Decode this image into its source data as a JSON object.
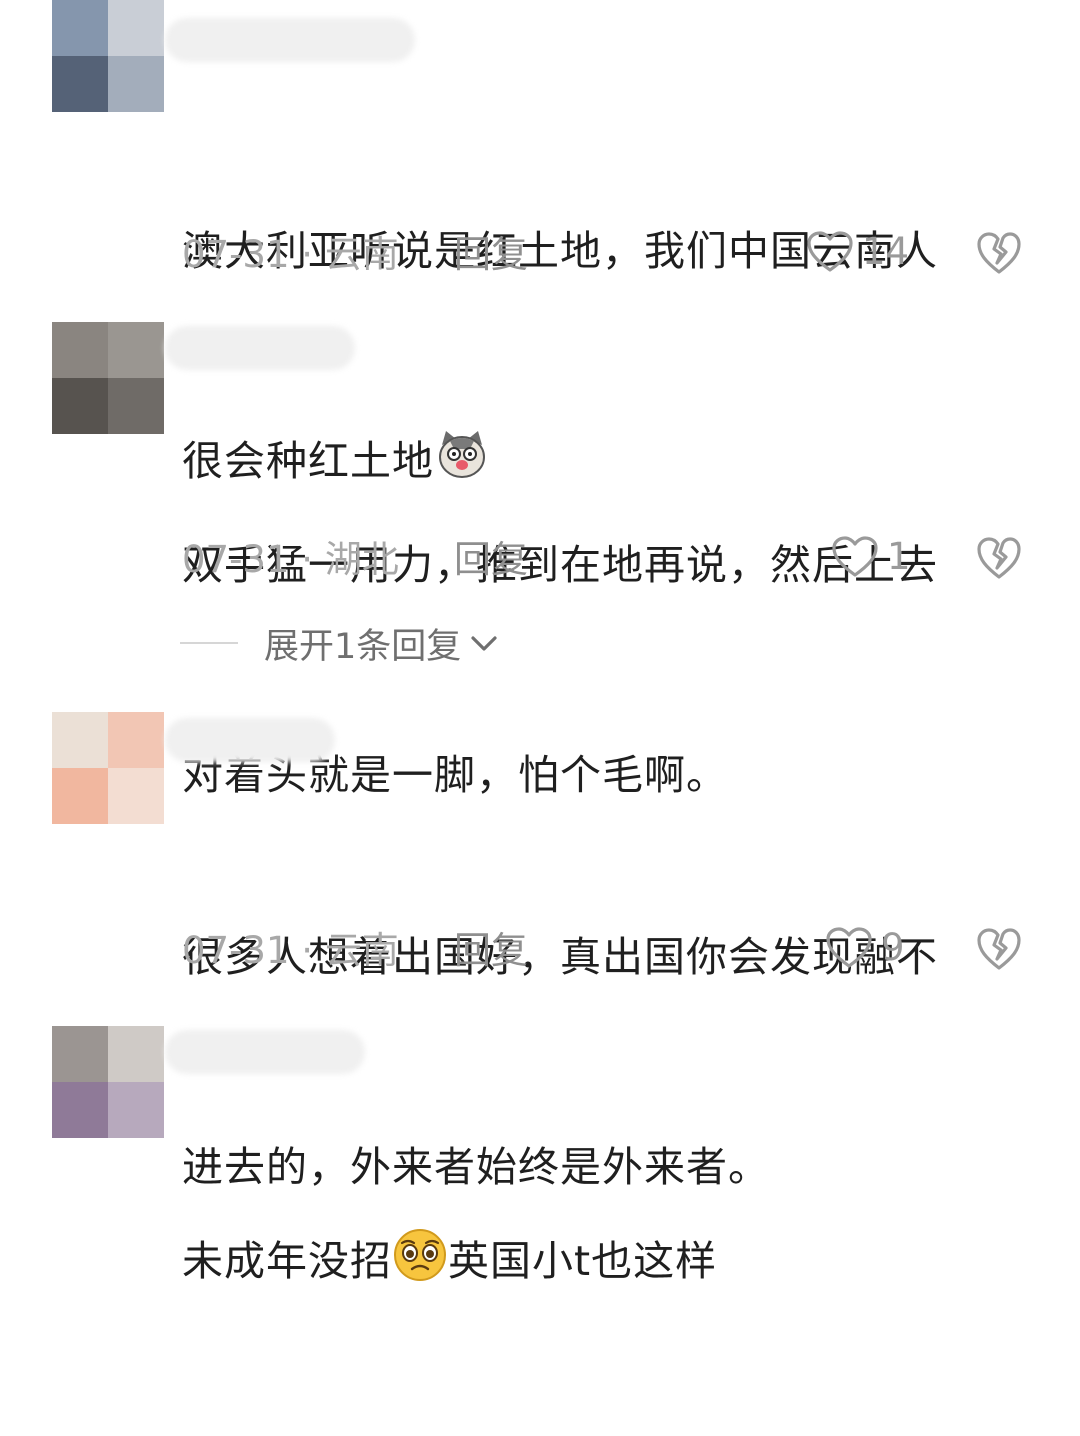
{
  "comments": [
    {
      "text_lines": [
        "澳大利亚听说是红土地，我们中国云南人",
        "很会种红土地"
      ],
      "emoji_name": "cat-face-emoji",
      "date": "07-31",
      "region": "云南",
      "reply_label": "回复",
      "likes": "14"
    },
    {
      "text_lines": [
        "双手猛一用力，推到在地再说，然后上去",
        "对着头就是一脚，怕个毛啊。"
      ],
      "date": "07-31",
      "region": "湖北",
      "reply_label": "回复",
      "likes": "1",
      "expand_label": "展开1条回复"
    },
    {
      "text_lines": [
        "很多人想着出国好，真出国你会发现融不",
        "进去的，外来者始终是外来者。"
      ],
      "date": "07-31",
      "region": "云南",
      "reply_label": "回复",
      "likes": "9"
    },
    {
      "text_before_emoji": "未成年没招",
      "emoji_name": "pleading-face-emoji",
      "text_after_emoji": "英国小t也这样"
    }
  ],
  "separator": " · ",
  "colors": {
    "meta_text": "#a8a8a8",
    "body_text": "#1f1f1f",
    "icon_stroke": "#9a9a9a"
  }
}
